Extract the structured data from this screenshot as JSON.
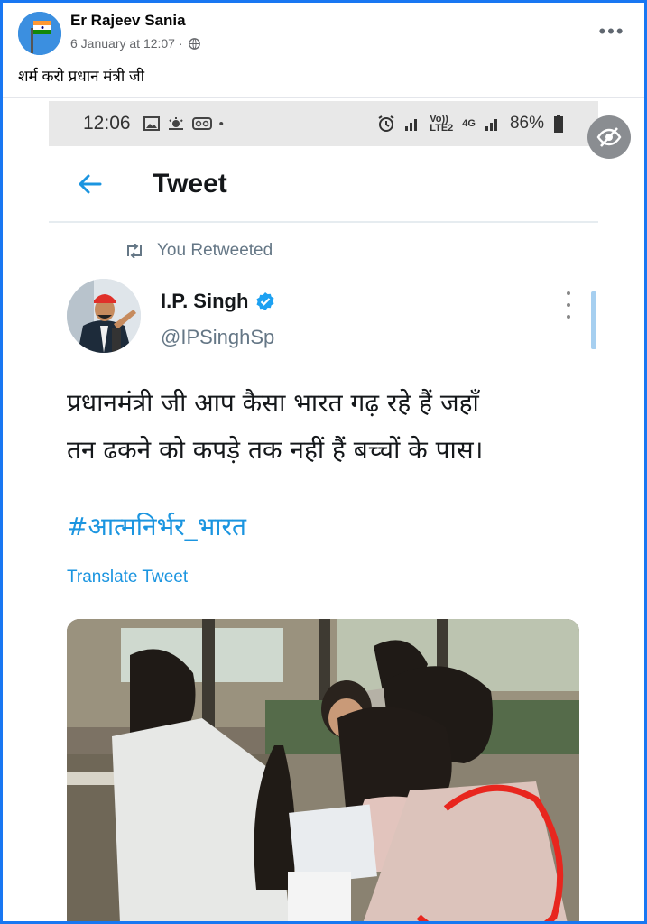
{
  "post": {
    "author": "Er Rajeev Sania",
    "date": "6 January at 12:07 ·",
    "text": "शर्म करो प्रधान मंत्री जी",
    "more_label": "•••"
  },
  "phone": {
    "status_time": "12:06",
    "battery": "86%",
    "network_top": "Vo))",
    "network_bottom": "LTE2",
    "network_4g": "4G"
  },
  "tweet": {
    "header_title": "Tweet",
    "retweet_label": "You Retweeted",
    "name": "I.P. Singh",
    "handle": "@IPSinghSp",
    "body_line1": "प्रधानमंत्री जी आप कैसा भारत गढ़ रहे हैं जहाँ",
    "body_line2": "तन ढकने को कपड़े तक नहीं हैं बच्चों के पास।",
    "hashtag": "#आत्मनिर्भर_भारत",
    "translate_label": "Translate Tweet"
  },
  "icons": {
    "back": "back-arrow-icon",
    "retweet": "retweet-icon",
    "verified": "verified-badge-icon",
    "globe": "globe-icon",
    "hide": "eye-slash-icon"
  },
  "colors": {
    "facebook_blue": "#1877f2",
    "twitter_blue": "#1b95e0",
    "text_gray": "#657786"
  }
}
